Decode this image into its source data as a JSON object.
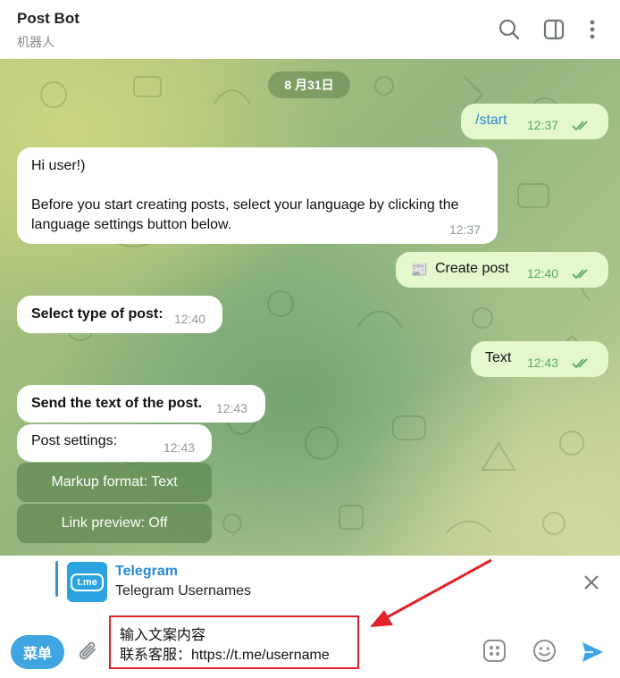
{
  "header": {
    "title": "Post Bot",
    "subtitle": "机器人",
    "icons": [
      "search-icon",
      "sidebar-toggle-icon",
      "more-vertical-icon"
    ]
  },
  "chat": {
    "date": "8 月31日",
    "messages": [
      {
        "id": "m1",
        "dir": "out",
        "text": "/start",
        "time": "12:37",
        "read": true
      },
      {
        "id": "m2",
        "dir": "in",
        "greeting": "Hi user!)",
        "text": "Before you start creating posts, select your language by clicking the language settings button below.",
        "time": "12:37"
      },
      {
        "id": "m3",
        "dir": "out",
        "emoji": "📰",
        "text": "Create post",
        "time": "12:40",
        "read": true
      },
      {
        "id": "m4",
        "dir": "in",
        "text": "Select type of post:",
        "time": "12:40"
      },
      {
        "id": "m5",
        "dir": "out",
        "text": "Text",
        "time": "12:43",
        "read": true
      },
      {
        "id": "m6",
        "dir": "in",
        "text": "Send the text of the post.",
        "time": "12:43"
      },
      {
        "id": "m7",
        "dir": "in",
        "text": "Post settings:",
        "time": "12:43"
      }
    ],
    "inline_buttons": [
      "Markup format: Text",
      "Link preview: Off"
    ]
  },
  "link_preview": {
    "logo_text": "t.me",
    "title": "Telegram",
    "subtitle": "Telegram Usernames"
  },
  "composer": {
    "menu_label": "菜单",
    "text_line1": "输入文案内容",
    "text_line2": "联系客服：https://t.me/username"
  },
  "colors": {
    "accent": "#3fa5e0",
    "outgoing_bubble": "#e4f7cd",
    "annotation": "#e0242a"
  }
}
